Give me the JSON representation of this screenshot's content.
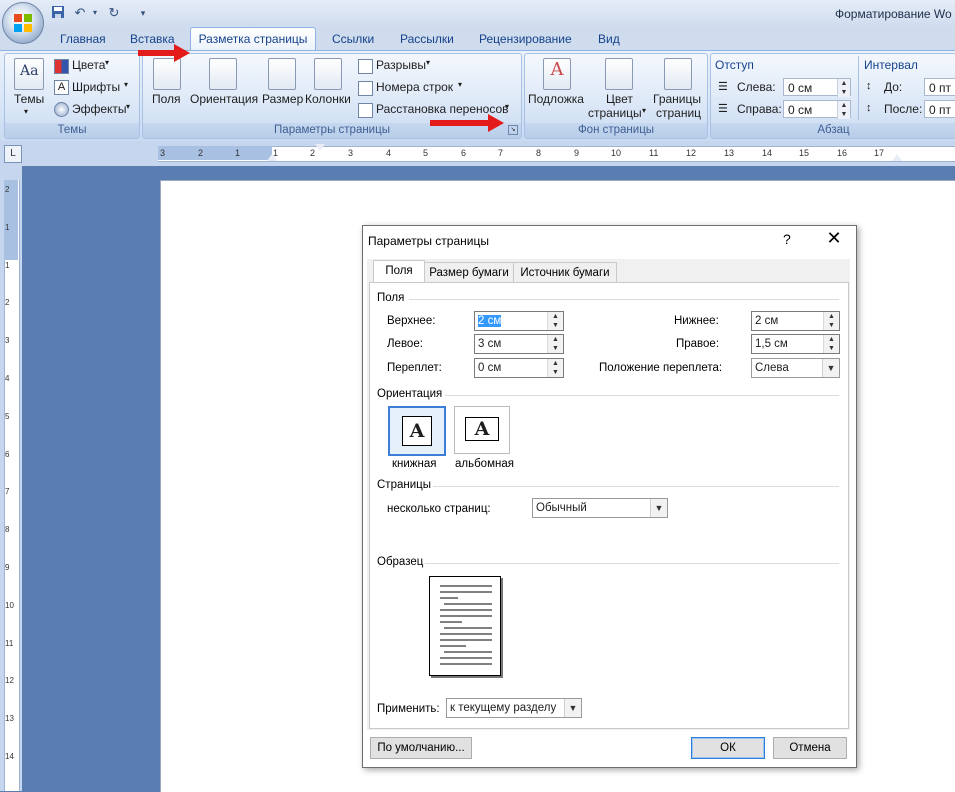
{
  "app": {
    "title": "Форматирование Wo"
  },
  "ribbon_tabs": [
    "Главная",
    "Вставка",
    "Разметка страницы",
    "Ссылки",
    "Рассылки",
    "Рецензирование",
    "Вид"
  ],
  "ribbon": {
    "themes": {
      "big_label": "Темы",
      "colors": "Цвета",
      "fonts": "Шрифты",
      "effects": "Эффекты",
      "group": "Темы"
    },
    "page_setup": {
      "margins": "Поля",
      "orientation": "Ориентация",
      "size": "Размер",
      "columns": "Колонки",
      "breaks": "Разрывы",
      "line_numbers": "Номера строк",
      "hyphenation": "Расстановка переносов",
      "group": "Параметры страницы"
    },
    "page_bg": {
      "watermark": "Подложка",
      "color_line1": "Цвет",
      "color_line2": "страницы",
      "borders_line1": "Границы",
      "borders_line2": "страниц",
      "group": "Фон страницы"
    },
    "paragraph": {
      "indent_title": "Отступ",
      "left": "Слева:",
      "left_val": "0 см",
      "right": "Справа:",
      "right_val": "0 см",
      "spacing_title": "Интервал",
      "before": "До:",
      "before_val": "0 пт",
      "after": "После:",
      "after_val": "0 пт",
      "group": "Абзац"
    }
  },
  "ruler": {
    "h_numbers": [
      "3",
      "2",
      "1",
      "1",
      "2",
      "3",
      "4",
      "5",
      "6",
      "7",
      "8",
      "9",
      "10",
      "11",
      "12",
      "13",
      "14",
      "15",
      "16",
      "17"
    ],
    "v_numbers": [
      "2",
      "1",
      "1",
      "2",
      "3",
      "4",
      "5",
      "6",
      "7",
      "8",
      "9",
      "10",
      "11",
      "12",
      "13",
      "14"
    ]
  },
  "dialog": {
    "title": "Параметры страницы",
    "help": "?",
    "close": "✕",
    "tabs": [
      "Поля",
      "Размер бумаги",
      "Источник бумаги"
    ],
    "margins_section": "Поля",
    "top_label": "Верхнее:",
    "top_value": "2 см",
    "bottom_label": "Нижнее:",
    "bottom_value": "2 см",
    "left_label": "Левое:",
    "left_value": "3 см",
    "right_label": "Правое:",
    "right_value": "1,5 см",
    "gutter_label": "Переплет:",
    "gutter_value": "0 см",
    "gutter_pos_label": "Положение переплета:",
    "gutter_pos_value": "Слева",
    "orientation_section": "Ориентация",
    "portrait": "книжная",
    "landscape": "альбомная",
    "glyph": "A",
    "pages_section": "Страницы",
    "multiple_pages_label": "несколько страниц:",
    "multiple_pages_value": "Обычный",
    "preview_section": "Образец",
    "apply_label": "Применить:",
    "apply_value": "к текущему разделу",
    "default_btn": "По умолчанию...",
    "ok_btn": "ОК",
    "cancel_btn": "Отмена"
  },
  "colors": {
    "accent": "#15428b",
    "arrow": "#e41b1b",
    "selection": "#3d7fd8"
  }
}
